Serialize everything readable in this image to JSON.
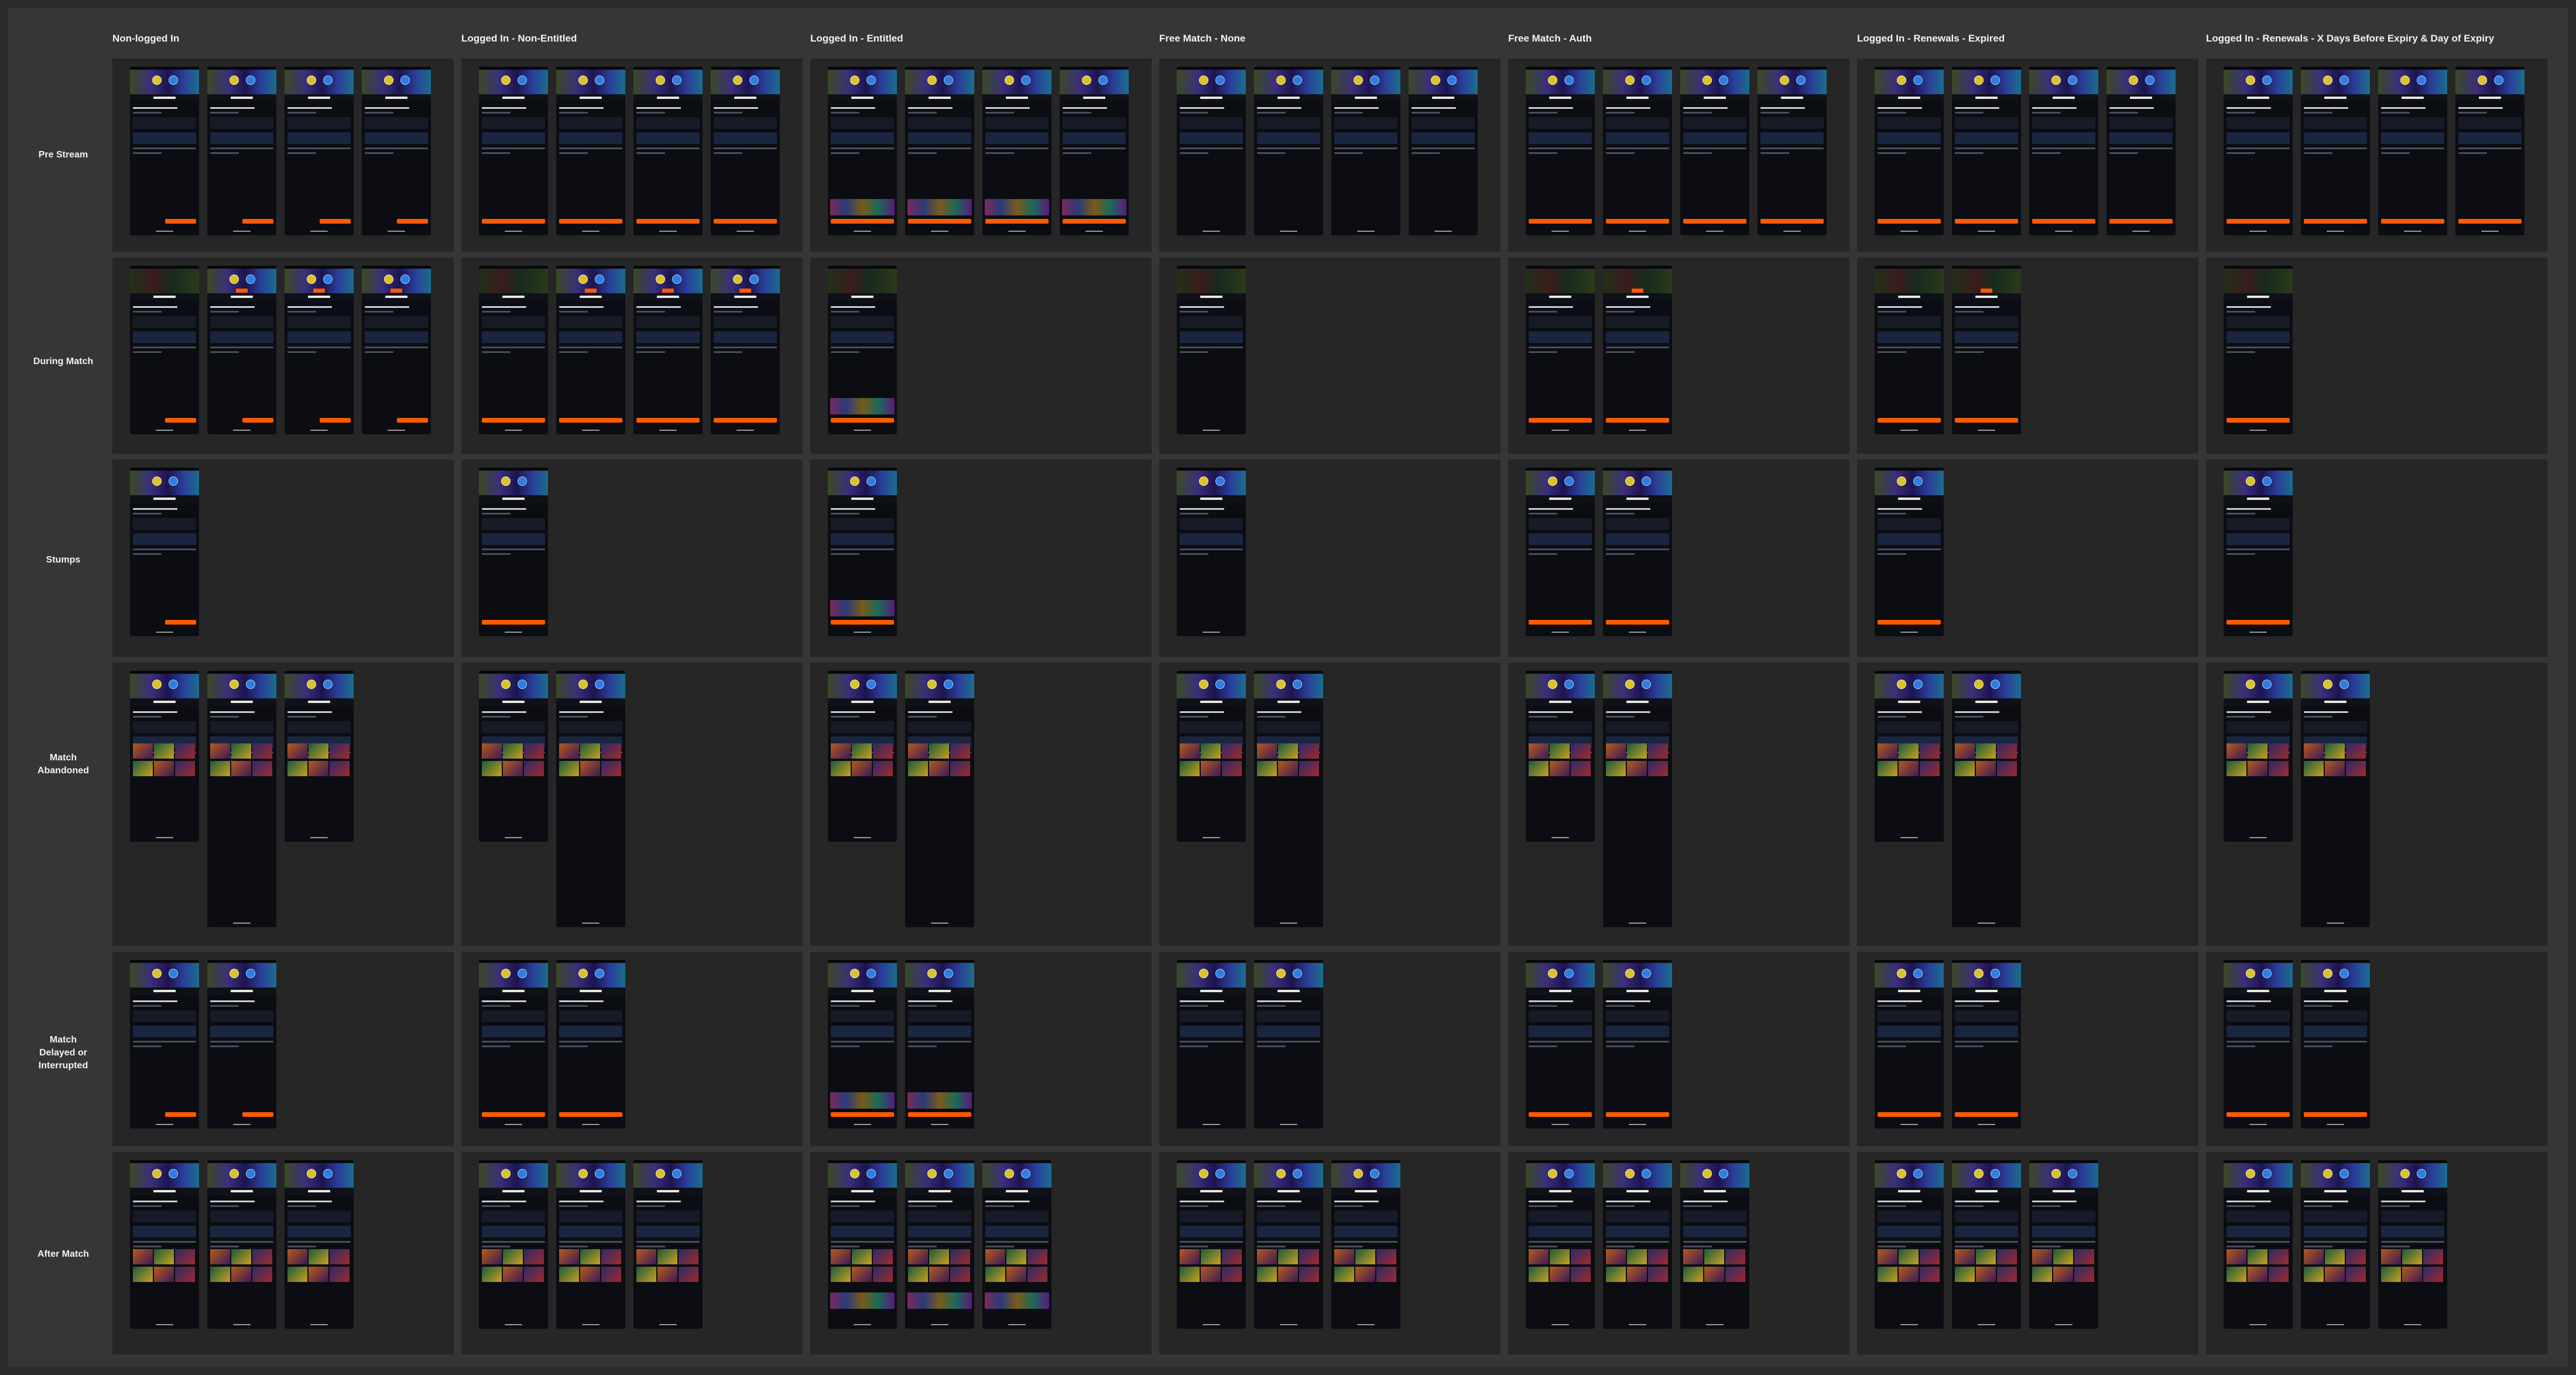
{
  "columns": [
    "Non-logged In",
    "Logged In - Non-Entitled",
    "Logged In - Entitled",
    "Free Match - None",
    "Free Match - Auth",
    "Logged In - Renewals - Expired",
    "Logged In - Renewals - X Days Before Expiry & Day of Expiry"
  ],
  "rows": [
    "Pre Stream",
    "During Match",
    "Stumps",
    "Match\nAbandoned",
    "Match\nDelayed or\nInterrupted",
    "After Match"
  ],
  "colors": {
    "background": "#2b2b2b",
    "board": "#363636",
    "cell": "#262626",
    "phone": "#0b0d12",
    "accent": "#ff5a00"
  },
  "screen_counts": [
    [
      4,
      4,
      4,
      4,
      4,
      4,
      4
    ],
    [
      4,
      4,
      1,
      1,
      2,
      2,
      1
    ],
    [
      1,
      1,
      1,
      1,
      2,
      1,
      1
    ],
    [
      3,
      2,
      2,
      2,
      2,
      2,
      2
    ],
    [
      2,
      2,
      2,
      2,
      2,
      2,
      2
    ],
    [
      3,
      3,
      3,
      3,
      3,
      3,
      3
    ]
  ]
}
